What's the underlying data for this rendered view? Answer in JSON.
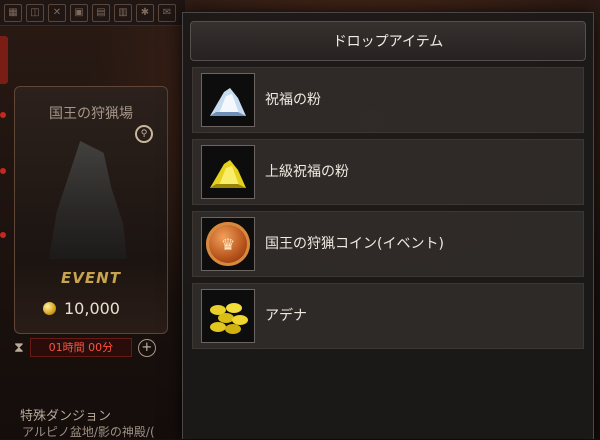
{
  "background": {
    "card": {
      "title": "国王の狩猟場",
      "event_label": "EVENT",
      "price": "10,000",
      "timer": "01時間 00分"
    },
    "footer": {
      "line1": "特殊ダンジョン",
      "line2": "アルピノ盆地/影の神殿/("
    }
  },
  "panel": {
    "title": "ドロップアイテム",
    "items": [
      {
        "name": "祝福の粉",
        "icon": "blessing-powder-icon"
      },
      {
        "name": "上級祝福の粉",
        "icon": "advanced-blessing-powder-icon"
      },
      {
        "name": "国王の狩猟コイン(イベント)",
        "icon": "king-hunting-coin-icon"
      },
      {
        "name": "アデナ",
        "icon": "adena-coins-icon"
      }
    ]
  }
}
